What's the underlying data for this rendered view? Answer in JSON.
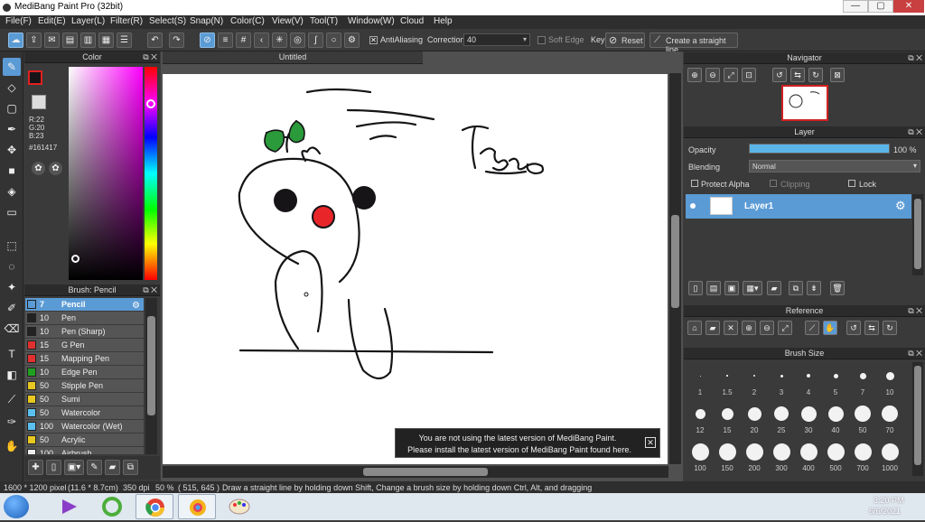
{
  "window": {
    "title": "MediBang Paint Pro (32bit)",
    "min": "—",
    "max": "▢",
    "close": "✕"
  },
  "menu": [
    "File(F)",
    "Edit(E)",
    "Layer(L)",
    "Filter(R)",
    "Select(S)",
    "Snap(N)",
    "Color(C)",
    "View(V)",
    "Tool(T)",
    "Window(W)",
    "Cloud",
    "Help"
  ],
  "toolbar": {
    "antialiasing": "AntiAliasing",
    "correction_label": "Correction",
    "correction_value": "40",
    "soft_edge": "Soft Edge",
    "key": "Key",
    "reset": "Reset",
    "straight_line": "Create a straight line"
  },
  "color_panel": {
    "title": "Color",
    "r": "R:22",
    "g": "G:20",
    "b": "B:23",
    "hex": "#161417",
    "fg_color": "#161417"
  },
  "brush_panel": {
    "title": "Brush: Pencil",
    "items": [
      {
        "size": "7",
        "name": "Pencil",
        "color": "#5b9bd5"
      },
      {
        "size": "10",
        "name": "Pen",
        "color": "#222222"
      },
      {
        "size": "10",
        "name": "Pen (Sharp)",
        "color": "#222222"
      },
      {
        "size": "15",
        "name": "G Pen",
        "color": "#e03030"
      },
      {
        "size": "15",
        "name": "Mapping Pen",
        "color": "#e03030"
      },
      {
        "size": "10",
        "name": "Edge Pen",
        "color": "#20a020"
      },
      {
        "size": "50",
        "name": "Stipple Pen",
        "color": "#e8c820"
      },
      {
        "size": "50",
        "name": "Sumi",
        "color": "#e8c820"
      },
      {
        "size": "50",
        "name": "Watercolor",
        "color": "#5bc0f0"
      },
      {
        "size": "100",
        "name": "Watercolor (Wet)",
        "color": "#5bc0f0"
      },
      {
        "size": "50",
        "name": "Acrylic",
        "color": "#e8c820"
      },
      {
        "size": "100",
        "name": "Airbrush",
        "color": "#eeeeee"
      }
    ]
  },
  "canvas": {
    "tab_title": "Untitled",
    "signature": "Thảo",
    "notice_line1": "You are not using the latest version of MediBang Paint.",
    "notice_line2": "Please install the latest version of MediBang Paint found here."
  },
  "navigator": {
    "title": "Navigator"
  },
  "layer_panel": {
    "title": "Layer",
    "opacity_label": "Opacity",
    "opacity_value": "100 %",
    "opacity": 1.0,
    "blending_label": "Blending",
    "blending_value": "Normal",
    "protect_alpha": "Protect Alpha",
    "clipping": "Clipping",
    "lock": "Lock",
    "layer_name": "Layer1"
  },
  "reference": {
    "title": "Reference"
  },
  "brush_size": {
    "title": "Brush Size",
    "sizes": [
      "1",
      "1.5",
      "2",
      "3",
      "4",
      "5",
      "7",
      "10",
      "12",
      "15",
      "20",
      "25",
      "30",
      "40",
      "50",
      "70",
      "100",
      "150",
      "200",
      "300",
      "400",
      "500",
      "700",
      "1000"
    ]
  },
  "status": {
    "size": "1600 * 1200 pixel",
    "cm": "(11.6 * 8.7cm)",
    "dpi": "350 dpi",
    "zoom": "50 %",
    "coords": "( 515, 645 )",
    "hint": "Draw a straight line by holding down Shift, Change a brush size by holding down Ctrl, Alt, and dragging"
  },
  "taskbar": {
    "time": "3:20 PM",
    "date": "6/6/2021"
  }
}
